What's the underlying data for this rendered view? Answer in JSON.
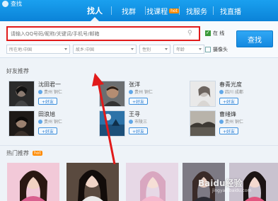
{
  "window": {
    "title": "查找"
  },
  "tabs": [
    {
      "label": "找人",
      "active": true
    },
    {
      "label": "找群"
    },
    {
      "label": "找课程",
      "badge": "hot"
    },
    {
      "label": "找服务"
    },
    {
      "label": "找直播"
    }
  ],
  "search": {
    "placeholder": "请输入QQ号码/昵称/关键词/手机号/邮箱",
    "online_label": "在 线",
    "online_checked": true,
    "button": "查找",
    "location_label": "所在地:中国",
    "hometown_label": "故乡:中国",
    "gender_label": "性别",
    "age_label": "年龄",
    "has_photo_label": "摄像头",
    "has_photo_checked": false
  },
  "friends_section": {
    "title": "好友推荐"
  },
  "friends": [
    {
      "name": "沈田君一",
      "location": "贵州 铜仁",
      "gender": "m",
      "add": "+好友"
    },
    {
      "name": "张洋",
      "location": "贵州 铜仁",
      "gender": "m",
      "add": "+好友"
    },
    {
      "name": "春青光度",
      "location": "四川 成都",
      "gender": "m",
      "add": "+好友"
    },
    {
      "name": "田浪旭",
      "location": "贵州 铜仁",
      "gender": "m",
      "add": "+好友"
    },
    {
      "name": "王寻",
      "location": "市陵三",
      "gender": "m",
      "add": "+好友"
    },
    {
      "name": "曹绪烽",
      "location": "贵州 铜仁",
      "gender": "m",
      "add": "+好友"
    }
  ],
  "hot_section": {
    "title": "热门推荐",
    "badge": "hot"
  },
  "watermark": {
    "main": "Baidu经验",
    "sub": "jingyan.baidu.com"
  },
  "colors": {
    "topbar": "#0b83d8",
    "highlight": "#e11a1a",
    "accent": "#1489e0"
  }
}
